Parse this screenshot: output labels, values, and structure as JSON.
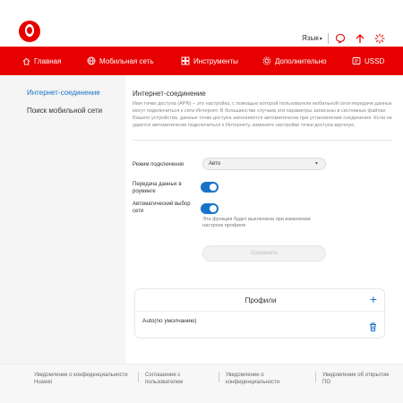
{
  "header": {
    "language": "Язык",
    "icons": [
      "vodafone-logo",
      "message-icon",
      "upload-icon",
      "loading-icon"
    ]
  },
  "nav": {
    "items": [
      {
        "label": "Главная",
        "icon": "home-icon"
      },
      {
        "label": "Мобильная сеть",
        "icon": "globe-icon"
      },
      {
        "label": "Инструменты",
        "icon": "tools-icon"
      },
      {
        "label": "Дополнительно",
        "icon": "gear-icon"
      },
      {
        "label": "USSD",
        "icon": "ussd-icon"
      }
    ]
  },
  "sidebar": {
    "items": [
      {
        "label": "Интернет-соединение",
        "active": true
      },
      {
        "label": "Поиск мобильной сети",
        "active": false
      }
    ]
  },
  "main": {
    "title": "Интернет-соединение",
    "description": "Имя точки доступа (APN) – это настройка, с помощью которой пользователи мобильной сети передачи данных могут подключиться к сети Интернет. В большинстве случаев эти параметры записаны в системных файлах Вашего устройства, данные точки доступа заполняются автоматически при установлении соединения. Если не удается автоматически подключиться к Интернету, измените настройки точки доступа вручную.",
    "mode_label": "Режим подключения",
    "mode_value": "Авто",
    "roaming_label": "Передача данных в роуминге",
    "roaming_on": true,
    "auto_network_label": "Автоматический выбор сети",
    "auto_network_on": true,
    "hint": "Эта функция будет выключена при изменении настроек профиля",
    "save_label": "Сохранить"
  },
  "profiles": {
    "title": "Профили",
    "items": [
      {
        "name": "Auto(по умолчанию)"
      }
    ]
  },
  "footer": {
    "links": [
      "Уведомление о конфиденциальности Huawei",
      "Соглашение с пользователем",
      "Уведомление о конфиденциальности",
      "Уведомление об открытом ПО"
    ]
  },
  "colors": {
    "brand": "#e60000",
    "accent": "#1a73c8"
  }
}
